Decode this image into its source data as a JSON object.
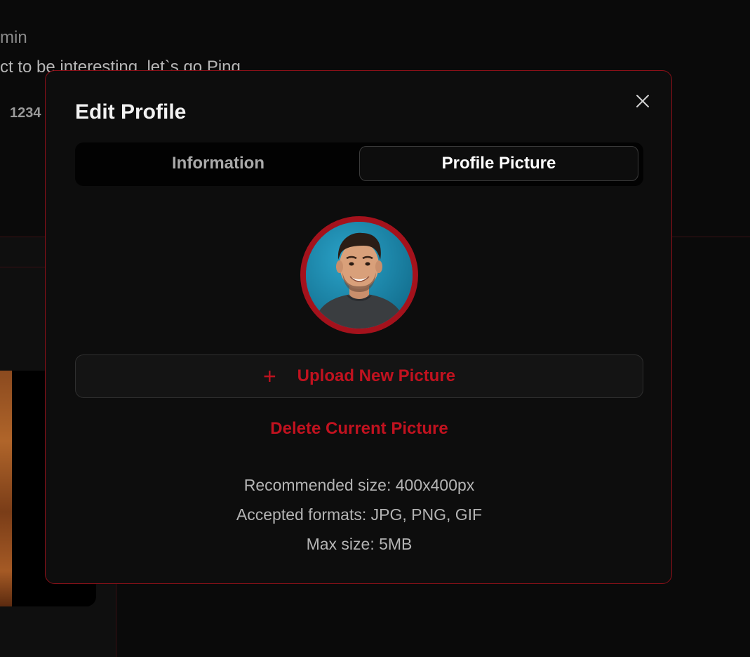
{
  "background": {
    "line1": "min",
    "line2": "ct to be interesting, let`s go Ping",
    "count": "1234"
  },
  "modal": {
    "title": "Edit Profile",
    "close_icon": "close-icon",
    "tabs": [
      {
        "label": "Information",
        "active": false
      },
      {
        "label": "Profile Picture",
        "active": true
      }
    ],
    "avatar": {
      "icon": "profile-avatar"
    },
    "upload": {
      "icon": "plus-icon",
      "plus_glyph": "+",
      "label": "Upload New Picture"
    },
    "delete_label": "Delete Current Picture",
    "info": [
      "Recommended size: 400x400px",
      "Accepted formats: JPG, PNG, GIF",
      "Max size: 5MB"
    ]
  },
  "colors": {
    "accent": "#c1121f",
    "modal_border": "#8a1018",
    "modal_bg": "#0d0d0d",
    "avatar_bg": "#1f8fb5"
  }
}
